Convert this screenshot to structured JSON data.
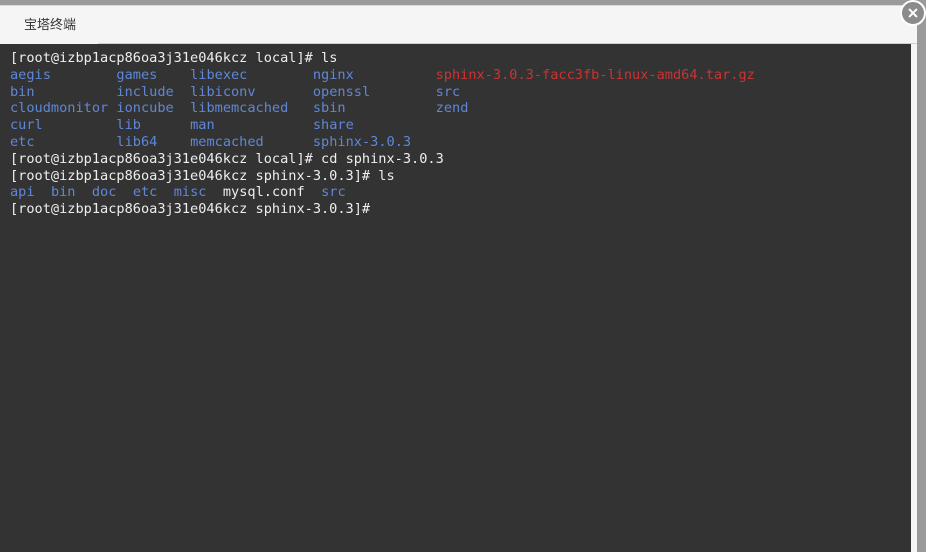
{
  "window": {
    "tab_title": "宝塔终端",
    "close_icon": "close-icon",
    "colors": {
      "terminal_background": "#333333",
      "header_background": "#f5f5f5",
      "directory_blue": "#5f87d7",
      "archive_red": "#cc3333",
      "default_text": "#eeeeee",
      "close_button": "#8b8b8b",
      "page_background": "#9a9a9a"
    }
  },
  "terminal": {
    "prompt_user_host_local": "[root@izbp1acp86oa3j31e046kcz local]#",
    "prompt_user_host_sphinx": "[root@izbp1acp86oa3j31e046kcz sphinx-3.0.3]#",
    "lines": [
      {
        "id": "cmd-ls-local",
        "segments": [
          {
            "text": "[root@izbp1acp86oa3j31e046kcz local]#",
            "color": "default"
          },
          {
            "text": " ls",
            "color": "default"
          }
        ]
      },
      {
        "id": "ls-row-1",
        "segments": [
          {
            "text": "aegis",
            "color": "dir"
          },
          {
            "text": "        ",
            "color": "default"
          },
          {
            "text": "games",
            "color": "dir"
          },
          {
            "text": "    ",
            "color": "default"
          },
          {
            "text": "libexec",
            "color": "dir"
          },
          {
            "text": "        ",
            "color": "default"
          },
          {
            "text": "nginx",
            "color": "dir"
          },
          {
            "text": "          ",
            "color": "default"
          },
          {
            "text": "sphinx-3.0.3-facc3fb-linux-amd64.tar.gz",
            "color": "archive"
          }
        ]
      },
      {
        "id": "ls-row-2",
        "segments": [
          {
            "text": "bin",
            "color": "dir"
          },
          {
            "text": "          ",
            "color": "default"
          },
          {
            "text": "include",
            "color": "dir"
          },
          {
            "text": "  ",
            "color": "default"
          },
          {
            "text": "libiconv",
            "color": "dir"
          },
          {
            "text": "       ",
            "color": "default"
          },
          {
            "text": "openssl",
            "color": "dir"
          },
          {
            "text": "        ",
            "color": "default"
          },
          {
            "text": "src",
            "color": "dir"
          }
        ]
      },
      {
        "id": "ls-row-3",
        "segments": [
          {
            "text": "cloudmonitor",
            "color": "dir"
          },
          {
            "text": " ",
            "color": "default"
          },
          {
            "text": "ioncube",
            "color": "dir"
          },
          {
            "text": "  ",
            "color": "default"
          },
          {
            "text": "libmemcached",
            "color": "dir"
          },
          {
            "text": "   ",
            "color": "default"
          },
          {
            "text": "sbin",
            "color": "dir"
          },
          {
            "text": "           ",
            "color": "default"
          },
          {
            "text": "zend",
            "color": "dir"
          }
        ]
      },
      {
        "id": "ls-row-4",
        "segments": [
          {
            "text": "curl",
            "color": "dir"
          },
          {
            "text": "         ",
            "color": "default"
          },
          {
            "text": "lib",
            "color": "dir"
          },
          {
            "text": "      ",
            "color": "default"
          },
          {
            "text": "man",
            "color": "dir"
          },
          {
            "text": "            ",
            "color": "default"
          },
          {
            "text": "share",
            "color": "dir"
          }
        ]
      },
      {
        "id": "ls-row-5",
        "segments": [
          {
            "text": "etc",
            "color": "dir"
          },
          {
            "text": "          ",
            "color": "default"
          },
          {
            "text": "lib64",
            "color": "dir"
          },
          {
            "text": "    ",
            "color": "default"
          },
          {
            "text": "memcached",
            "color": "dir"
          },
          {
            "text": "      ",
            "color": "default"
          },
          {
            "text": "sphinx-3.0.3",
            "color": "dir"
          }
        ]
      },
      {
        "id": "cmd-cd-sphinx",
        "segments": [
          {
            "text": "[root@izbp1acp86oa3j31e046kcz local]#",
            "color": "default"
          },
          {
            "text": " cd sphinx-3.0.3",
            "color": "default"
          }
        ]
      },
      {
        "id": "cmd-ls-sphinx",
        "segments": [
          {
            "text": "[root@izbp1acp86oa3j31e046kcz sphinx-3.0.3]#",
            "color": "default"
          },
          {
            "text": " ls",
            "color": "default"
          }
        ]
      },
      {
        "id": "ls-sphinx-row-1",
        "segments": [
          {
            "text": "api",
            "color": "dir"
          },
          {
            "text": "  ",
            "color": "default"
          },
          {
            "text": "bin",
            "color": "dir"
          },
          {
            "text": "  ",
            "color": "default"
          },
          {
            "text": "doc",
            "color": "dir"
          },
          {
            "text": "  ",
            "color": "default"
          },
          {
            "text": "etc",
            "color": "dir"
          },
          {
            "text": "  ",
            "color": "default"
          },
          {
            "text": "misc",
            "color": "dir"
          },
          {
            "text": "  ",
            "color": "default"
          },
          {
            "text": "mysql.conf",
            "color": "default"
          },
          {
            "text": "  ",
            "color": "default"
          },
          {
            "text": "src",
            "color": "dir"
          }
        ]
      },
      {
        "id": "prompt-current",
        "segments": [
          {
            "text": "[root@izbp1acp86oa3j31e046kcz sphinx-3.0.3]#",
            "color": "default"
          }
        ]
      }
    ]
  }
}
